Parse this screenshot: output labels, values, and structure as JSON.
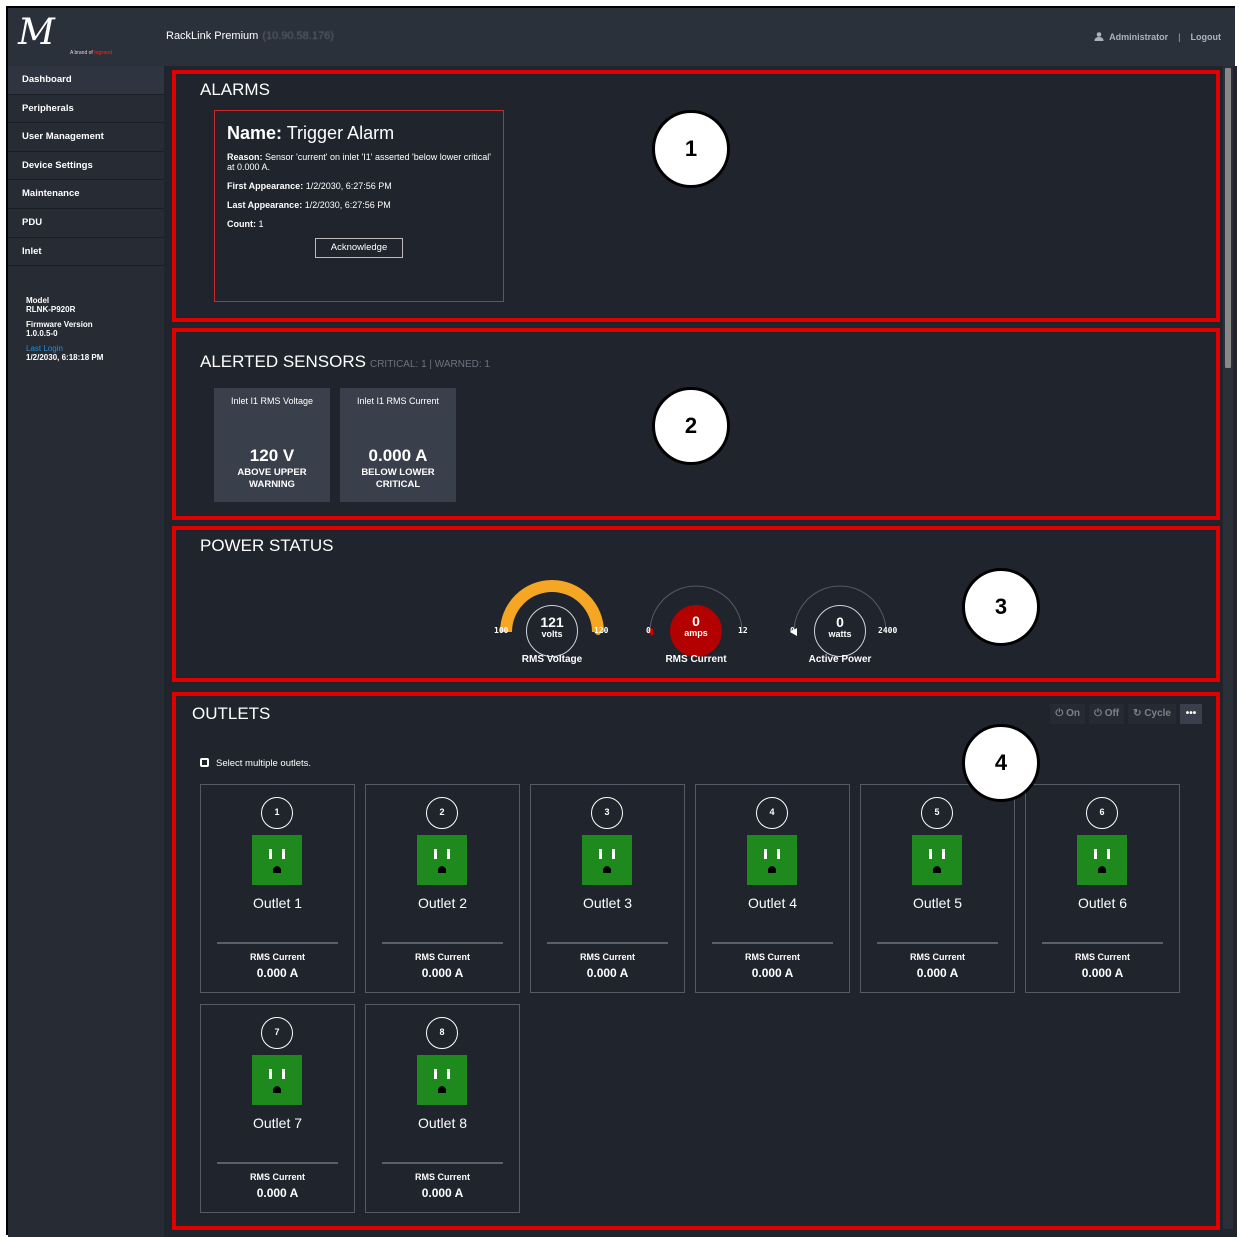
{
  "header": {
    "logo_text": "M",
    "logo_sub": "A brand of",
    "logo_brand": "legrand",
    "app_title": "RackLink Premium",
    "app_ip": "(10.90.58.176)",
    "user": "Administrator",
    "separator": "|",
    "logout": "Logout"
  },
  "sidebar": {
    "items": [
      {
        "label": "Dashboard"
      },
      {
        "label": "Peripherals"
      },
      {
        "label": "User Management"
      },
      {
        "label": "Device Settings"
      },
      {
        "label": "Maintenance"
      },
      {
        "label": "PDU"
      },
      {
        "label": "Inlet"
      }
    ],
    "model_label": "Model",
    "model_value": "RLNK-P920R",
    "firmware_label": "Firmware Version",
    "firmware_value": "1.0.0.5-0",
    "last_login_label": "Last Login",
    "last_login_value": "1/2/2030, 6:18:18 PM"
  },
  "alarms": {
    "title": "ALARMS",
    "callout": "1",
    "name_label": "Name:",
    "name_value": "Trigger Alarm",
    "reason_label": "Reason:",
    "reason_value": "Sensor 'current' on inlet 'I1' asserted 'below lower critical' at 0.000 A.",
    "first_label": "First Appearance:",
    "first_value": "1/2/2030, 6:27:56 PM",
    "last_label": "Last Appearance:",
    "last_value": "1/2/2030, 6:27:56 PM",
    "count_label": "Count:",
    "count_value": "1",
    "ack_label": "Acknowledge"
  },
  "sensors": {
    "title": "ALERTED SENSORS",
    "summary": "CRITICAL: 1 | WARNED: 1",
    "callout": "2",
    "tiles": [
      {
        "name": "Inlet I1 RMS Voltage",
        "value": "120 V",
        "state_line1": "ABOVE UPPER",
        "state_line2": "WARNING"
      },
      {
        "name": "Inlet I1 RMS Current",
        "value": "0.000 A",
        "state_line1": "BELOW LOWER",
        "state_line2": "CRITICAL"
      }
    ]
  },
  "power": {
    "title": "POWER STATUS",
    "callout": "3",
    "gauges": [
      {
        "value": "121",
        "unit": "volts",
        "min": "100",
        "max": "120",
        "label": "RMS Voltage",
        "fraction": 1.0,
        "color": "#f5a623",
        "center_bg": "#1f242d"
      },
      {
        "value": "0",
        "unit": "amps",
        "min": "0",
        "max": "12",
        "label": "RMS Current",
        "fraction": 0.0,
        "color": "#cc0000",
        "center_bg": "#b30000"
      },
      {
        "value": "0",
        "unit": "watts",
        "min": "0",
        "max": "2400",
        "label": "Active Power",
        "fraction": 0.0,
        "color": "#ffffff",
        "center_bg": "#1f242d"
      }
    ]
  },
  "outlets": {
    "title": "OUTLETS",
    "callout": "4",
    "tools": {
      "on": "On",
      "off": "Off",
      "cycle": "Cycle",
      "more": "•••"
    },
    "select_multiple": "Select multiple outlets.",
    "items": [
      {
        "num": "1",
        "name": "Outlet 1",
        "metric": "RMS Current",
        "value": "0.000 A"
      },
      {
        "num": "2",
        "name": "Outlet 2",
        "metric": "RMS Current",
        "value": "0.000 A"
      },
      {
        "num": "3",
        "name": "Outlet 3",
        "metric": "RMS Current",
        "value": "0.000 A"
      },
      {
        "num": "4",
        "name": "Outlet 4",
        "metric": "RMS Current",
        "value": "0.000 A"
      },
      {
        "num": "5",
        "name": "Outlet 5",
        "metric": "RMS Current",
        "value": "0.000 A"
      },
      {
        "num": "6",
        "name": "Outlet 6",
        "metric": "RMS Current",
        "value": "0.000 A"
      },
      {
        "num": "7",
        "name": "Outlet 7",
        "metric": "RMS Current",
        "value": "0.000 A"
      },
      {
        "num": "8",
        "name": "Outlet 8",
        "metric": "RMS Current",
        "value": "0.000 A"
      }
    ]
  }
}
